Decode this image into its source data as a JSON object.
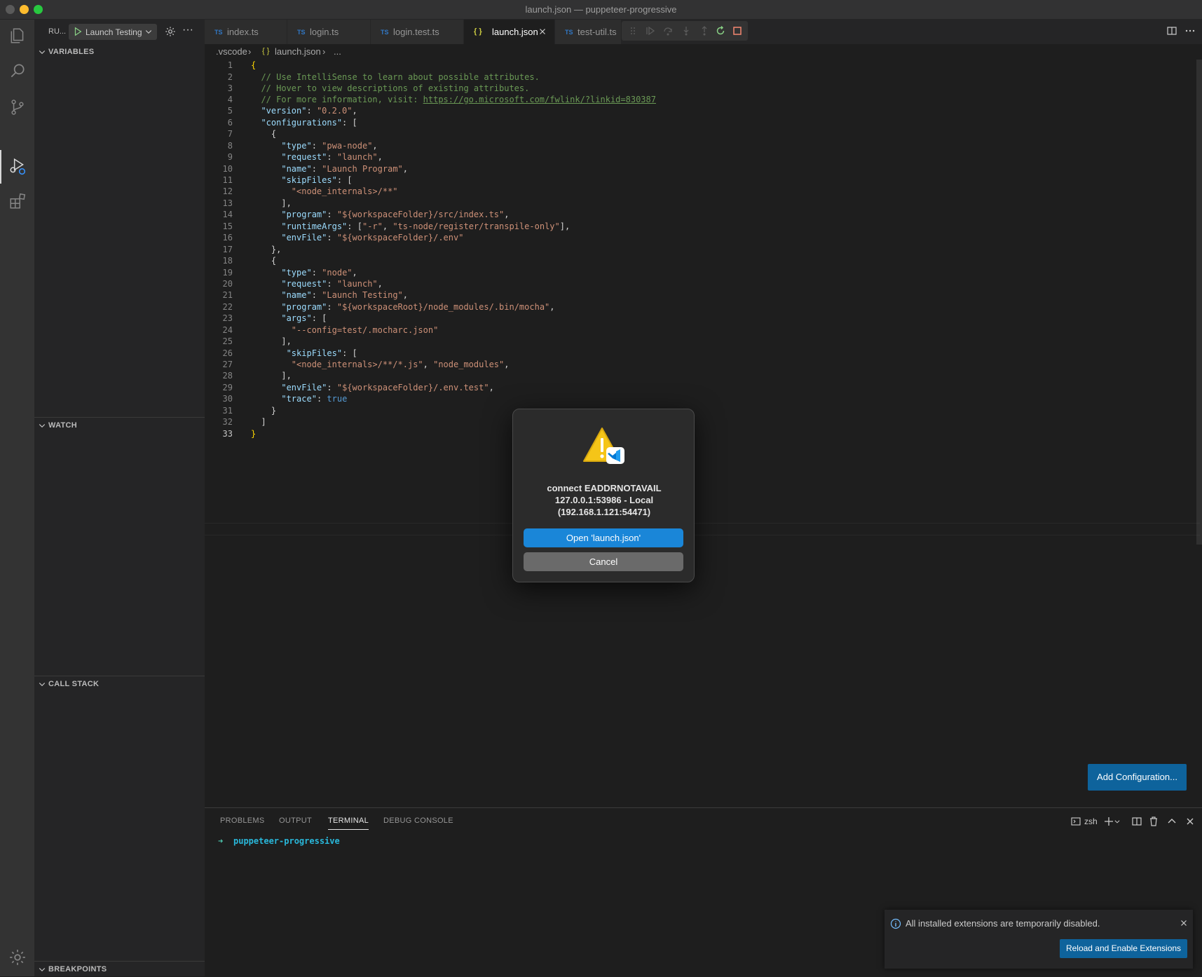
{
  "window": {
    "title": "launch.json — puppeteer-progressive"
  },
  "sidebar": {
    "run_label": "RU...",
    "launch_config": "Launch Testing",
    "more": "···",
    "sections": [
      "VARIABLES",
      "WATCH",
      "CALL STACK",
      "BREAKPOINTS"
    ]
  },
  "tabs": [
    {
      "lang": "TS",
      "label": "index.ts"
    },
    {
      "lang": "TS",
      "label": "login.ts"
    },
    {
      "lang": "TS",
      "label": "login.test.ts"
    },
    {
      "lang": "{ }",
      "label": "launch.json",
      "active": true
    },
    {
      "lang": "TS",
      "label": "test-util.ts"
    }
  ],
  "breadcrumb": {
    "folder": ".vscode",
    "sep": "›",
    "file_icon": "{ }",
    "file": "launch.json",
    "rest": "..."
  },
  "editor": {
    "current_line": "33",
    "line_numbers": [
      "1",
      "2",
      "3",
      "4",
      "5",
      "6",
      "7",
      "8",
      "9",
      "10",
      "11",
      "12",
      "13",
      "14",
      "15",
      "16",
      "17",
      "18",
      "19",
      "20",
      "21",
      "22",
      "23",
      "24",
      "25",
      "26",
      "27",
      "28",
      "29",
      "30",
      "31",
      "32",
      "33"
    ],
    "tokens": {
      "brace_open": "{",
      "comment1": "// Use IntelliSense to learn about possible attributes.",
      "comment2": "// Hover to view descriptions of existing attributes.",
      "comment3_prefix": "// For more information, visit: ",
      "comment3_link": "https://go.microsoft.com/fwlink/?linkid=830387",
      "k_version": "\"version\"",
      "v_version": "\"0.2.0\"",
      "k_configurations": "\"configurations\"",
      "k_type": "\"type\"",
      "v_pwa": "\"pwa-node\"",
      "k_request": "\"request\"",
      "v_launch": "\"launch\"",
      "k_name": "\"name\"",
      "v_launch_program": "\"Launch Program\"",
      "k_skipFiles": "\"skipFiles\"",
      "v_node_internals": "\"<node_internals>/**\"",
      "k_program": "\"program\"",
      "v_program1": "\"${workspaceFolder}/src/index.ts\"",
      "k_runtimeArgs": "\"runtimeArgs\"",
      "v_r": "\"-r\"",
      "v_tsnode": "\"ts-node/register/transpile-only\"",
      "k_envFile": "\"envFile\"",
      "v_env1": "\"${workspaceFolder}/.env\"",
      "v_node": "\"node\"",
      "v_launch_testing": "\"Launch Testing\"",
      "v_program2": "\"${workspaceRoot}/node_modules/.bin/mocha\"",
      "k_args": "\"args\"",
      "v_config": "\"--config=test/.mocharc.json\"",
      "v_node_internals_js": "\"<node_internals>/**/*.js\"",
      "v_node_modules": "\"node_modules\"",
      "v_env2": "\"${workspaceFolder}/.env.test\"",
      "k_trace": "\"trace\"",
      "v_true": "true",
      "brace_close": "}"
    }
  },
  "add_configuration": "Add Configuration...",
  "panel": {
    "tabs": [
      "PROBLEMS",
      "OUTPUT",
      "TERMINAL",
      "DEBUG CONSOLE"
    ],
    "active_tab": "TERMINAL",
    "shell": "zsh",
    "prompt_symbol": "➜",
    "prompt_dir": "puppeteer-progressive"
  },
  "notification": {
    "message": "All installed extensions are temporarily disabled.",
    "button": "Reload and Enable Extensions"
  },
  "dialog": {
    "line1": "connect EADDRNOTAVAIL",
    "line2": "127.0.0.1:53986 - Local",
    "line3": "(192.168.1.121:54471)",
    "open_button": "Open 'launch.json'",
    "cancel_button": "Cancel"
  },
  "colors": {
    "accent": "#0e639c",
    "dialog_primary": "#1a86d8",
    "warning": "#f5c518"
  }
}
